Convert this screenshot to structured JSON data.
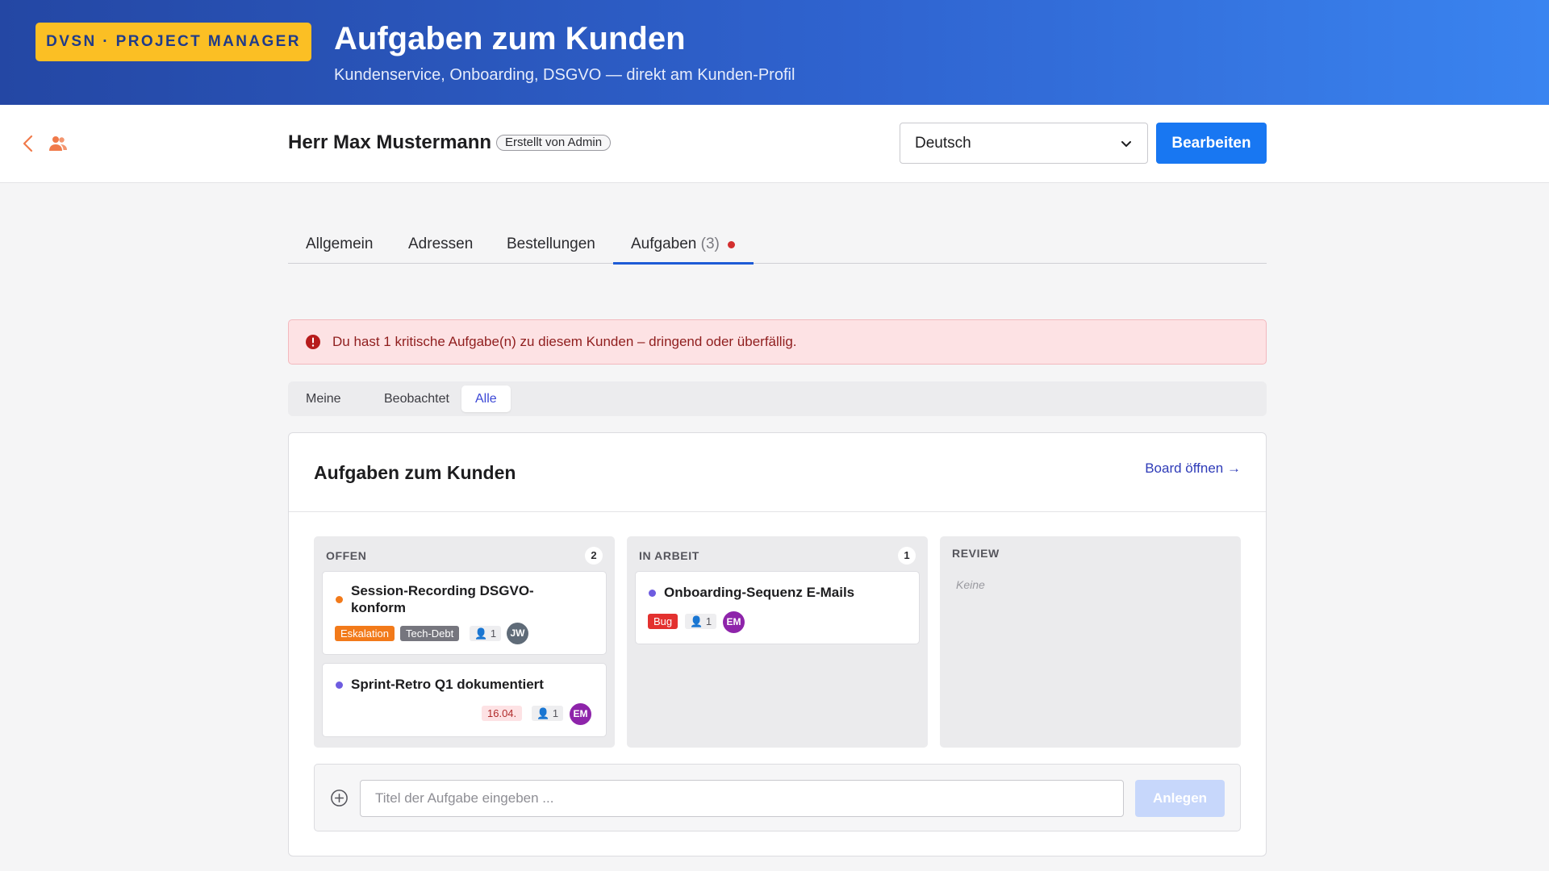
{
  "banner": {
    "brand": "DVSN · PROJECT MANAGER",
    "title": "Aufgaben zum Kunden",
    "subtitle": "Kundenservice, Onboarding, DSGVO — direkt am Kunden-Profil"
  },
  "header": {
    "customer_name": "Herr Max Mustermann",
    "created_by": "Erstellt von Admin",
    "language": "Deutsch",
    "edit_label": "Bearbeiten"
  },
  "tabs": [
    {
      "label": "Allgemein"
    },
    {
      "label": "Adressen"
    },
    {
      "label": "Bestellungen"
    },
    {
      "label": "Aufgaben",
      "count": "(3)",
      "active": true
    }
  ],
  "alert": {
    "text": "Du hast 1 kritische Aufgabe(n) zu diesem Kunden – dringend oder überfällig."
  },
  "filters": [
    {
      "label": "Meine"
    },
    {
      "label": "Beobachtet"
    },
    {
      "label": "Alle",
      "active": true
    }
  ],
  "panel": {
    "title": "Aufgaben zum Kunden",
    "board_link": "Board öffnen →",
    "columns": [
      {
        "title": "OFFEN",
        "count": "2",
        "cards": [
          {
            "title": "Session-Recording DSGVO-konform",
            "dot_color": "#f27a1a",
            "tags": [
              "Eskalation",
              "Tech-Debt"
            ],
            "watchers": "1",
            "avatar": "JW",
            "avatar_color": "#5f6b78"
          },
          {
            "title": "Sprint-Retro Q1 dokumentiert",
            "dot_color": "#6e5ce0",
            "due": "16.04.",
            "watchers": "1",
            "avatar": "EM",
            "avatar_color": "#8e24aa"
          }
        ]
      },
      {
        "title": "IN ARBEIT",
        "count": "1",
        "cards": [
          {
            "title": "Onboarding-Sequenz E-Mails",
            "dot_color": "#6e5ce0",
            "tags": [
              "Bug"
            ],
            "watchers": "1",
            "avatar": "EM",
            "avatar_color": "#8e24aa"
          }
        ]
      },
      {
        "title": "REVIEW",
        "empty": "Keine"
      }
    ]
  },
  "new_task": {
    "placeholder": "Titel der Aufgabe eingeben ...",
    "create_label": "Anlegen"
  },
  "colors": {
    "accent": "#1877f2",
    "brand_badge": "#fbbf24",
    "alert_bg": "#fde2e4"
  }
}
